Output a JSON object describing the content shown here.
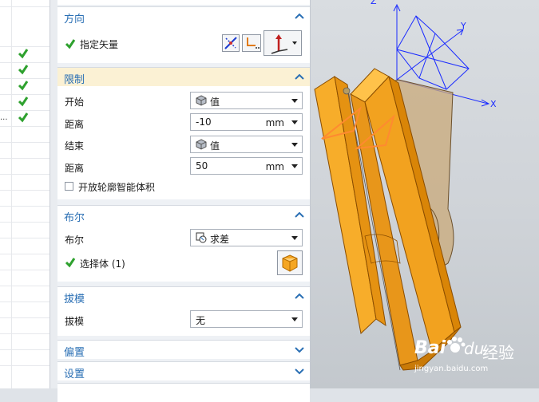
{
  "left_strip": {
    "ellipsis": "..."
  },
  "sections": {
    "direction": {
      "title": "方向",
      "specify_vector_label": "指定矢量"
    },
    "limits": {
      "title": "限制",
      "start_label": "开始",
      "start_value": "值",
      "start_distance_label": "距离",
      "start_distance_value": "-10",
      "start_distance_unit": "mm",
      "end_label": "结束",
      "end_value": "值",
      "end_distance_label": "距离",
      "end_distance_value": "50",
      "end_distance_unit": "mm",
      "open_profile_label": "开放轮廓智能体积"
    },
    "boolean": {
      "title": "布尔",
      "boolean_label": "布尔",
      "boolean_value": "求差",
      "select_body_label": "选择体 (1)"
    },
    "draft": {
      "title": "拔模",
      "draft_label": "拔模",
      "draft_value": "无"
    },
    "offset": {
      "title": "偏置"
    },
    "settings": {
      "title": "设置"
    }
  },
  "viewport": {
    "axis_x": "X",
    "axis_y": "Y",
    "axis_z": "Z",
    "watermark_brand": "Bai",
    "watermark_du": "du",
    "watermark_jingyan": "经验",
    "watermark_url": "jingyan.baidu.com"
  },
  "colors": {
    "section_title": "#2a6fb4",
    "active_header": "#fbf1d4",
    "check_green": "#2ea12e",
    "part_orange": "#f0a020",
    "axis_blue": "#1a2bff"
  }
}
